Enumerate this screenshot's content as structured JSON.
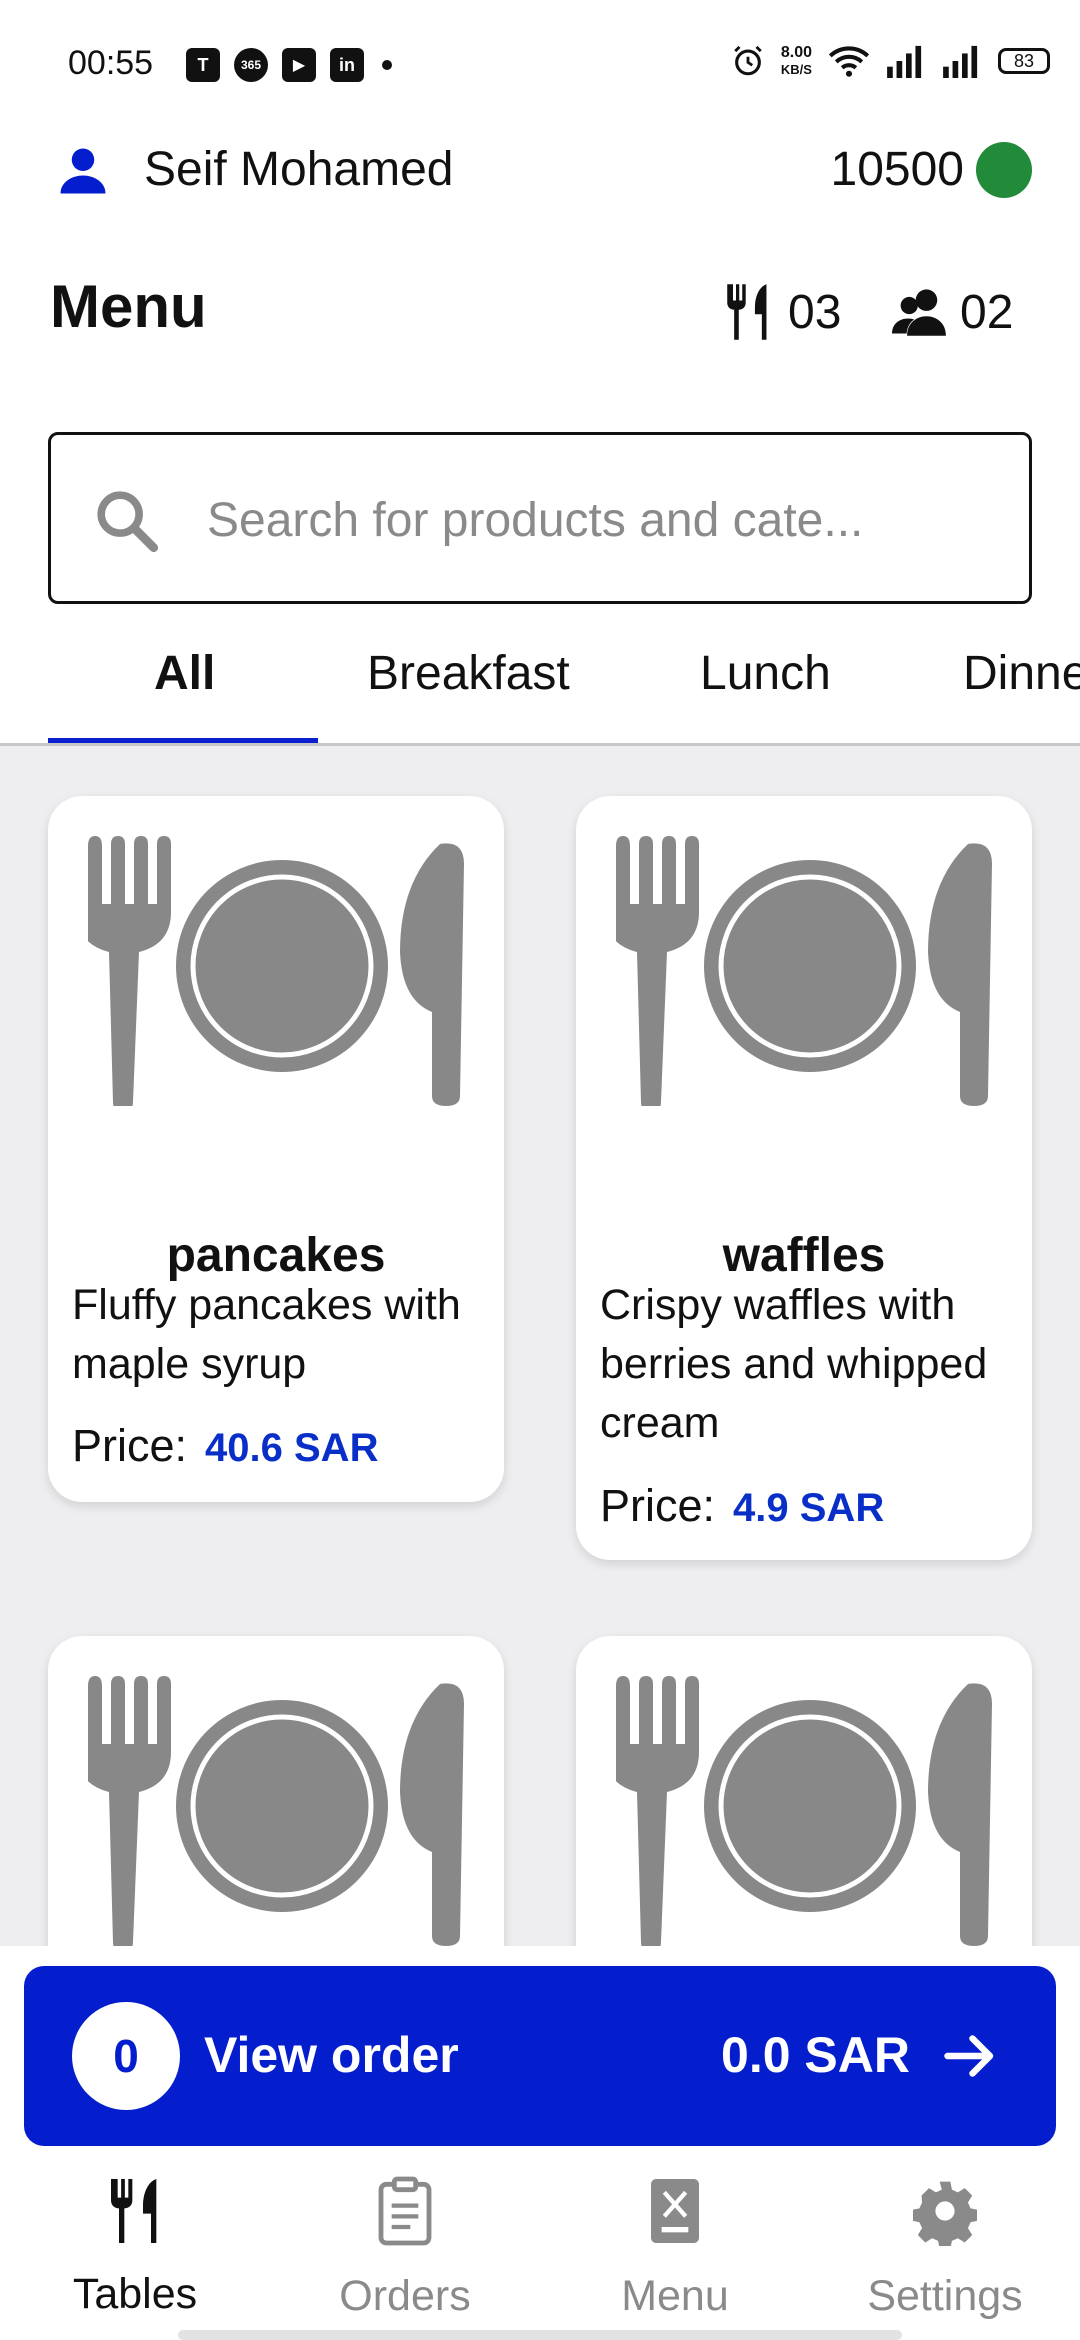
{
  "status_bar": {
    "time": "00:55",
    "apps": [
      "teams-icon",
      "office365-icon",
      "youtube-icon",
      "linkedin-icon"
    ],
    "app_glyphs": [
      "T",
      "365",
      "▶",
      "in"
    ],
    "speed_value": "8.00",
    "speed_unit": "KB/S",
    "battery": "83"
  },
  "user": {
    "name": "Seif Mohamed",
    "balance": "10500",
    "status_color": "#228b3a"
  },
  "header": {
    "title": "Menu",
    "tables_count": "03",
    "guests_count": "02"
  },
  "search": {
    "placeholder": "Search for products and cate..."
  },
  "tabs": [
    {
      "label": "All",
      "active": true
    },
    {
      "label": "Breakfast",
      "active": false
    },
    {
      "label": "Lunch",
      "active": false
    },
    {
      "label": "Dinner",
      "active": false
    }
  ],
  "products": [
    {
      "name": "pancakes",
      "description": "Fluffy pancakes with maple syrup",
      "price_label": "Price:",
      "price": "40.6 SAR"
    },
    {
      "name": "waffles",
      "description": "Crispy waffles with berries and whipped cream",
      "price_label": "Price:",
      "price": "4.9 SAR"
    },
    {
      "name": "",
      "description": "",
      "price_label": "",
      "price": ""
    },
    {
      "name": "",
      "description": "",
      "price_label": "",
      "price": ""
    }
  ],
  "order_bar": {
    "count": "0",
    "label": "View order",
    "total": "0.0 SAR"
  },
  "bottom_nav": [
    {
      "label": "Tables",
      "icon": "tables-icon",
      "active": true
    },
    {
      "label": "Orders",
      "icon": "clipboard-icon",
      "active": false
    },
    {
      "label": "Menu",
      "icon": "menu-book-icon",
      "active": false
    },
    {
      "label": "Settings",
      "icon": "gear-icon",
      "active": false
    }
  ],
  "colors": {
    "accent": "#051ecd",
    "price": "#0a2fc8",
    "grid_bg": "#eeeef0",
    "placeholder_gray": "#8a8a8a"
  }
}
